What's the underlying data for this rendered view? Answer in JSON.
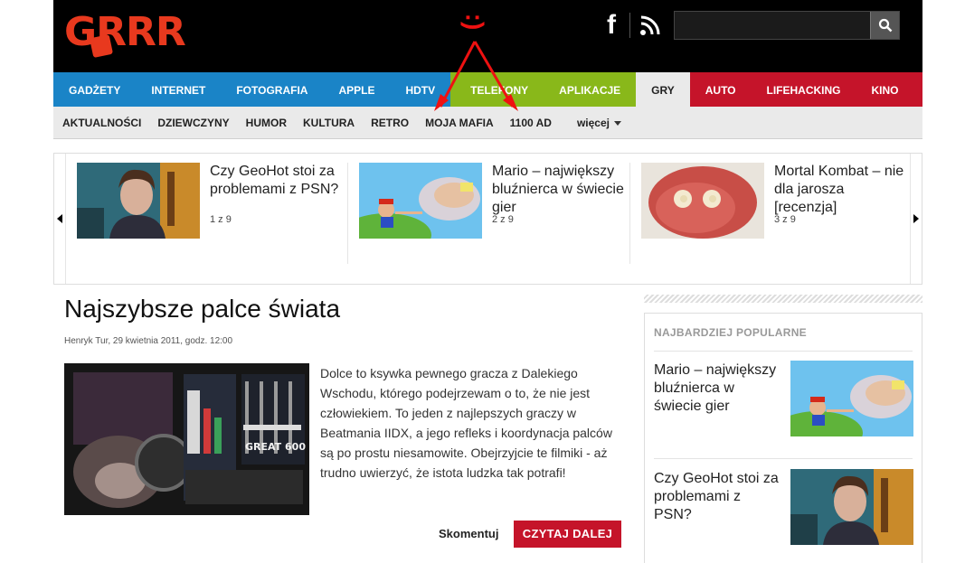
{
  "header": {
    "logo_text": "GRRR",
    "annotation": ":)",
    "search_placeholder": ""
  },
  "nav": {
    "items": [
      {
        "label": "GADŻETY",
        "style": "blue"
      },
      {
        "label": "INTERNET",
        "style": "blue"
      },
      {
        "label": "FOTOGRAFIA",
        "style": "blue"
      },
      {
        "label": "APPLE",
        "style": "blue"
      },
      {
        "label": "HDTV",
        "style": "blue"
      },
      {
        "label": "TELEFONY",
        "style": "green"
      },
      {
        "label": "APLIKACJE",
        "style": "green"
      },
      {
        "label": "GRY",
        "style": "active"
      },
      {
        "label": "AUTO",
        "style": "red"
      },
      {
        "label": "LIFEHACKING",
        "style": "red"
      },
      {
        "label": "KINO",
        "style": "red"
      }
    ]
  },
  "subnav": {
    "items": [
      "AKTUALNOŚCI",
      "DZIEWCZYNY",
      "HUMOR",
      "KULTURA",
      "RETRO",
      "MOJA MAFIA",
      "1100 AD"
    ],
    "more_label": "więcej"
  },
  "carousel": {
    "items": [
      {
        "title": "Czy GeoHot stoi za problemami z PSN?",
        "count": "1 z 9"
      },
      {
        "title": "Mario – największy bluźnierca w świecie gier",
        "count": "2 z 9"
      },
      {
        "title": "Mortal Kombat – nie dla jarosza [recenzja]",
        "count": "3 z 9"
      }
    ]
  },
  "article": {
    "title": "Najszybsze palce świata",
    "byline": "Henryk Tur, 29 kwietnia 2011, godz. 12:00",
    "body": "Dolce to ksywka pewnego gracza z Dalekiego Wschodu, którego podejrzewam o to, że nie jest człowiekiem. To jeden z najlepszych graczy w Beatmania IIDX, a jego refleks i koordynacja palców są po prostu niesamowite. Obejrzyjcie te filmiki - aż trudno uwierzyć, że istota ludzka tak potrafi!",
    "comment_label": "Skomentuj",
    "read_more_label": "CZYTAJ DALEJ",
    "thumb_text": "GREAT 600"
  },
  "sidebar": {
    "heading": "NAJBARDZIEJ POPULARNE",
    "items": [
      {
        "title": "Mario – największy bluźnierca w świecie gier"
      },
      {
        "title": "Czy GeoHot stoi za problemami z PSN?"
      }
    ]
  },
  "colors": {
    "nav_blue": "#1a84c7",
    "nav_green": "#89b81a",
    "nav_red": "#c5142a",
    "logo_red": "#e8391e",
    "annotation_red": "#e11111"
  }
}
